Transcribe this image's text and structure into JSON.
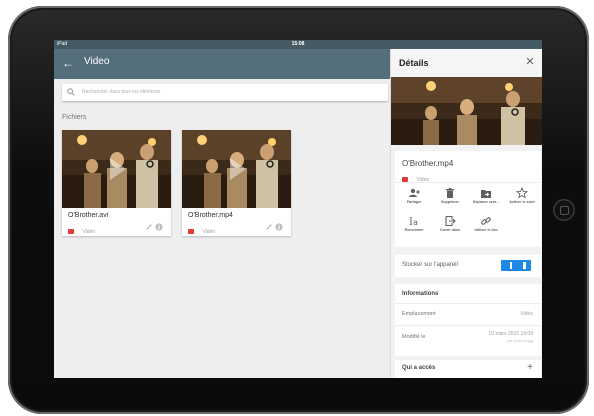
{
  "status_bar": {
    "carrier": "iPad",
    "time": "15:08"
  },
  "app_bar": {
    "title": "Video"
  },
  "search": {
    "placeholder": "Rechercher dans tous les éléments"
  },
  "files_section": {
    "label": "Fichiers"
  },
  "files": [
    {
      "name": "O'Brother.avi",
      "type": "Vidéo"
    },
    {
      "name": "O'Brother.mp4",
      "type": "Vidéo"
    }
  ],
  "details": {
    "title": "Détails",
    "file_name": "O'Brother.mp4",
    "file_type": "Vidéo",
    "actions": [
      {
        "icon": "add-person-icon",
        "label": "Partager"
      },
      {
        "icon": "trash-icon",
        "label": "Supprimer"
      },
      {
        "icon": "move-folder-icon",
        "label": "Déplacer vers..."
      },
      {
        "icon": "star-icon",
        "label": "Activer le suivi"
      },
      {
        "icon": "rename-icon",
        "label": "Renommer"
      },
      {
        "icon": "open-in-icon",
        "label": "Ouvrir dans"
      },
      {
        "icon": "link-icon",
        "label": "Utiliser le lien"
      }
    ],
    "store_on_device": {
      "label": "Stocker sur l'appareil",
      "enabled": true
    },
    "informations": {
      "heading": "Informations",
      "location_label": "Emplacement",
      "location_value": "Vidéo",
      "modified_label": "Modifié le",
      "modified_value": "10 mars 2015 19:09",
      "modified_by": "par yvan.mogg"
    },
    "access": {
      "heading": "Qui a accès"
    }
  },
  "colors": {
    "status_bar": "#455a64",
    "app_bar": "#546e7a",
    "toggle_on": "#1e88e5",
    "video_badge": "#e53935"
  }
}
